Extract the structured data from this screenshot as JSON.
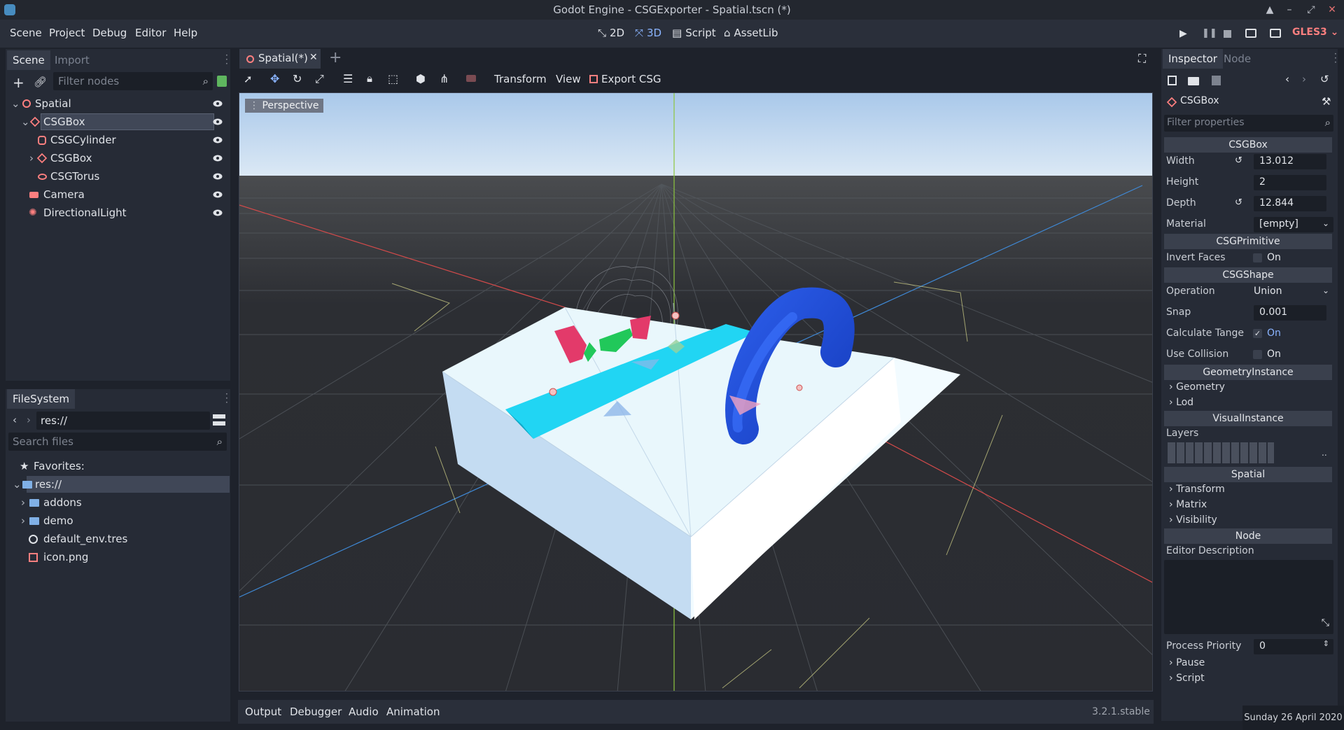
{
  "window": {
    "title": "Godot Engine - CSGExporter - Spatial.tscn (*)"
  },
  "menu": {
    "items": [
      "Scene",
      "Project",
      "Debug",
      "Editor",
      "Help"
    ]
  },
  "modes": {
    "m2d": "2D",
    "m3d": "3D",
    "script": "Script",
    "assetlib": "AssetLib",
    "renderer": "GLES3"
  },
  "scene_panel": {
    "tab_scene": "Scene",
    "tab_import": "Import",
    "filter_placeholder": "Filter nodes",
    "nodes": [
      "Spatial",
      "CSGBox",
      "CSGCylinder",
      "CSGBox",
      "CSGTorus",
      "Camera",
      "DirectionalLight"
    ]
  },
  "filesystem": {
    "tab": "FileSystem",
    "path": "res://",
    "search_placeholder": "Search files",
    "favorites": "Favorites:",
    "root": "res://",
    "items": [
      "addons",
      "demo",
      "default_env.tres",
      "icon.png"
    ]
  },
  "editor": {
    "tab": "Spatial(*)",
    "toolbar": {
      "transform": "Transform",
      "view": "View",
      "export": "Export CSG"
    },
    "perspective": "Perspective"
  },
  "bottom": {
    "tabs": [
      "Output",
      "Debugger",
      "Audio",
      "Animation"
    ],
    "version": "3.2.1.stable"
  },
  "inspector": {
    "tab_inspector": "Inspector",
    "tab_node": "Node",
    "object": "CSGBox",
    "filter_placeholder": "Filter properties",
    "sections": {
      "csgbox": "CSGBox",
      "csgprimitive": "CSGPrimitive",
      "csgshape": "CSGShape",
      "geometry": "GeometryInstance",
      "visual": "VisualInstance",
      "spatial": "Spatial",
      "node": "Node"
    },
    "props": {
      "width_label": "Width",
      "width": "13.012",
      "height_label": "Height",
      "height": "2",
      "depth_label": "Depth",
      "depth": "12.844",
      "material_label": "Material",
      "material": "[empty]",
      "invert_label": "Invert Faces",
      "invert": "On",
      "operation_label": "Operation",
      "operation": "Union",
      "snap_label": "Snap",
      "snap": "0.001",
      "tangent_label": "Calculate Tange",
      "tangent": "On",
      "collision_label": "Use Collision",
      "collision": "On",
      "geometry": "Geometry",
      "lod": "Lod",
      "layers_label": "Layers",
      "layers_more": "..",
      "transform": "Transform",
      "matrix": "Matrix",
      "visibility": "Visibility",
      "editor_desc": "Editor Description",
      "priority_label": "Process Priority",
      "priority": "0",
      "pause": "Pause",
      "script": "Script"
    }
  },
  "clock": "Sunday 26 April 2020",
  "colors": {
    "accent": "#8ab4ff",
    "node_red": "#fc7f7f",
    "panel": "#262b36"
  }
}
